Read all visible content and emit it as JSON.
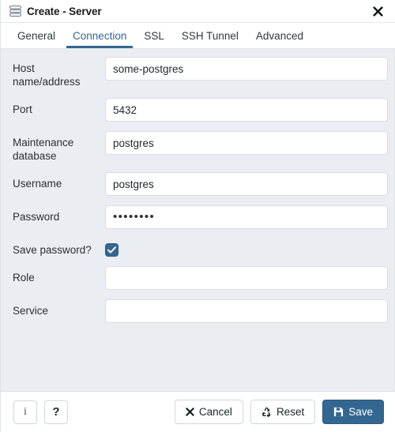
{
  "window": {
    "title": "Create - Server",
    "icon": "server-stack-icon",
    "close_label": "✕",
    "accent_color": "#336791",
    "body_background": "#eaedf1"
  },
  "tabs": [
    {
      "label": "General",
      "active": false
    },
    {
      "label": "Connection",
      "active": true
    },
    {
      "label": "SSL",
      "active": false
    },
    {
      "label": "SSH Tunnel",
      "active": false
    },
    {
      "label": "Advanced",
      "active": false
    }
  ],
  "form": {
    "fields": [
      {
        "label": "Host name/address",
        "value": "some-postgres",
        "placeholder": "",
        "type": "text"
      },
      {
        "label": "Port",
        "value": "5432",
        "placeholder": "",
        "type": "text"
      },
      {
        "label": "Maintenance database",
        "value": "postgres",
        "placeholder": "",
        "type": "text"
      },
      {
        "label": "Username",
        "value": "postgres",
        "placeholder": "",
        "type": "text"
      },
      {
        "label": "Password",
        "value": "••••••••",
        "placeholder": "",
        "type": "password"
      },
      {
        "label": "Save password?",
        "value": "checked",
        "type": "checkbox"
      },
      {
        "label": "Role",
        "value": "",
        "placeholder": "",
        "type": "text"
      },
      {
        "label": "Service",
        "value": "",
        "placeholder": "",
        "type": "text"
      }
    ]
  },
  "footer": {
    "info_label": "i",
    "help_label": "?",
    "cancel_label": "Cancel",
    "reset_label": "Reset",
    "save_label": "Save"
  }
}
